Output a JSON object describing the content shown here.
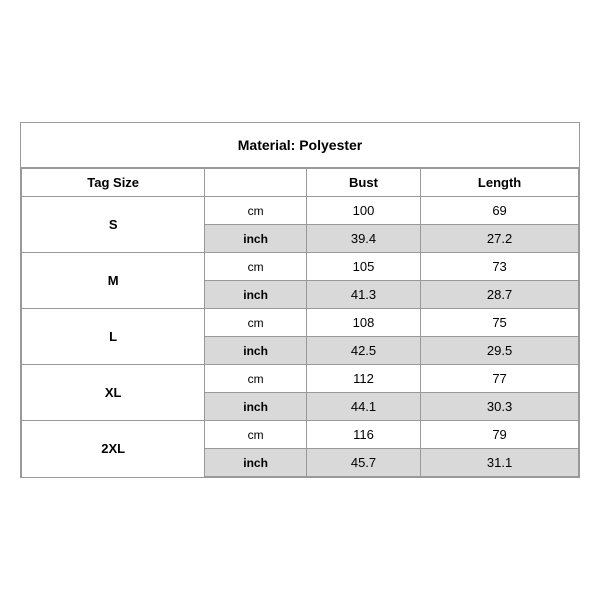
{
  "title": "Material: Polyester",
  "headers": {
    "tag_size": "Tag Size",
    "bust": "Bust",
    "length": "Length"
  },
  "rows": [
    {
      "size": "S",
      "cm": {
        "bust": "100",
        "length": "69"
      },
      "inch": {
        "bust": "39.4",
        "length": "27.2"
      }
    },
    {
      "size": "M",
      "cm": {
        "bust": "105",
        "length": "73"
      },
      "inch": {
        "bust": "41.3",
        "length": "28.7"
      }
    },
    {
      "size": "L",
      "cm": {
        "bust": "108",
        "length": "75"
      },
      "inch": {
        "bust": "42.5",
        "length": "29.5"
      }
    },
    {
      "size": "XL",
      "cm": {
        "bust": "112",
        "length": "77"
      },
      "inch": {
        "bust": "44.1",
        "length": "30.3"
      }
    },
    {
      "size": "2XL",
      "cm": {
        "bust": "116",
        "length": "79"
      },
      "inch": {
        "bust": "45.7",
        "length": "31.1"
      }
    }
  ],
  "units": {
    "cm": "cm",
    "inch": "inch"
  }
}
